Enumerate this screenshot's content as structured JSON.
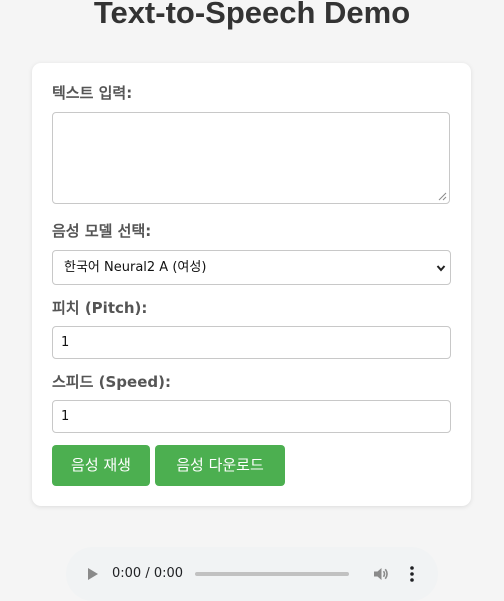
{
  "page": {
    "title": "Text-to-Speech Demo"
  },
  "form": {
    "text_label": "텍스트 입력:",
    "text_value": "",
    "model_label": "음성 모델 선택:",
    "model_selected": "한국어 Neural2 A (여성)",
    "pitch_label": "피치 (Pitch):",
    "pitch_value": "1",
    "speed_label": "스피드 (Speed):",
    "speed_value": "1"
  },
  "buttons": {
    "play_label": "음성 재생",
    "download_label": "음성 다운로드"
  },
  "audio": {
    "time": "0:00 / 0:00",
    "progress": 0
  },
  "colors": {
    "accent": "#4caf50",
    "background": "#f5f5f5",
    "card": "#ffffff"
  },
  "icons": {
    "play": "play-icon",
    "volume": "volume-icon",
    "menu": "more-vertical-icon",
    "chevron": "chevron-down-icon"
  }
}
